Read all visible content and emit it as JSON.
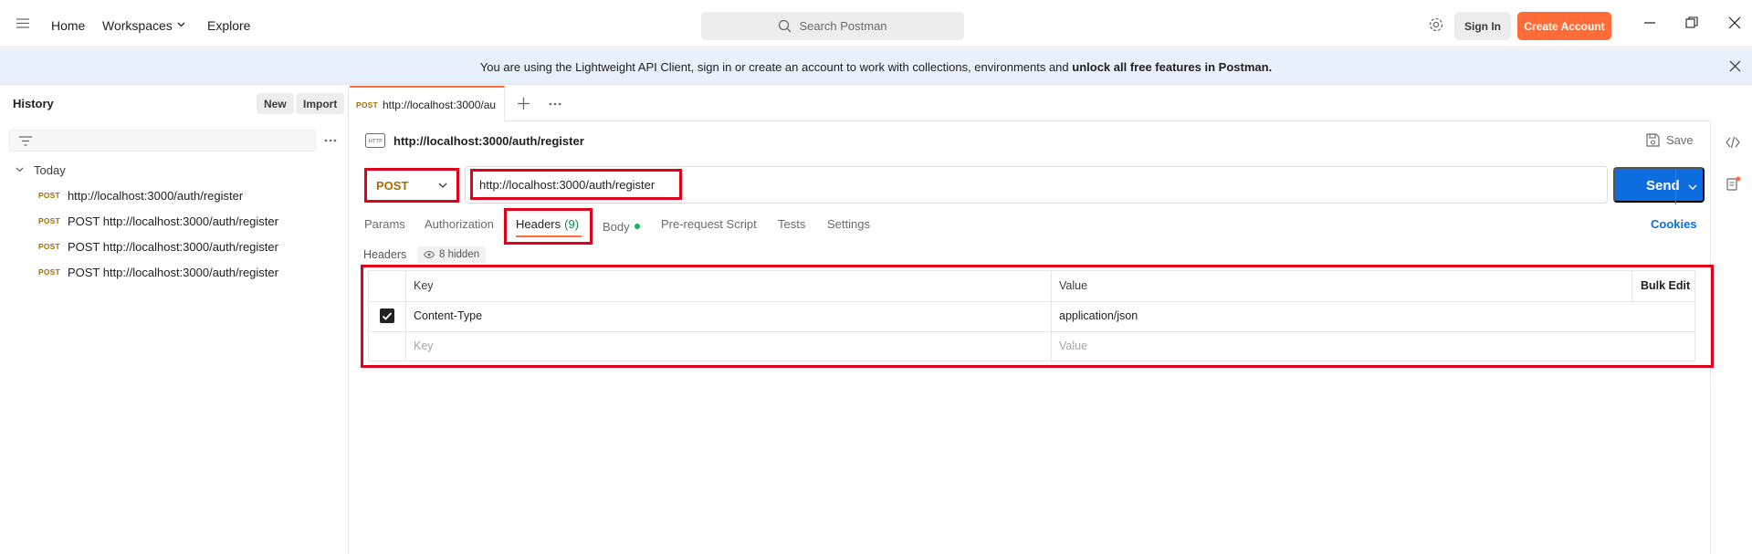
{
  "topbar": {
    "nav": {
      "home": "Home",
      "workspaces": "Workspaces",
      "explore": "Explore"
    },
    "search_placeholder": "Search Postman",
    "sign_in": "Sign In",
    "create_account": "Create Account"
  },
  "banner": {
    "text": "You are using the Lightweight API Client, sign in or create an account to work with collections, environments and ",
    "bold": "unlock all free features in Postman."
  },
  "sidebar": {
    "title": "History",
    "new_label": "New",
    "import_label": "Import",
    "group": "Today",
    "items": [
      {
        "method": "POST",
        "text": "http://localhost:3000/auth/register"
      },
      {
        "method": "POST",
        "text": "POST http://localhost:3000/auth/register"
      },
      {
        "method": "POST",
        "text": "POST http://localhost:3000/auth/register"
      },
      {
        "method": "POST",
        "text": "POST http://localhost:3000/auth/register"
      }
    ]
  },
  "tabs": {
    "active": {
      "method": "POST",
      "title": "http://localhost:3000/au"
    }
  },
  "request": {
    "title": "http://localhost:3000/auth/register",
    "save_label": "Save",
    "method": "POST",
    "url": "http://localhost:3000/auth/register",
    "send_label": "Send",
    "cookies_label": "Cookies",
    "subtabs": {
      "params": "Params",
      "authorization": "Authorization",
      "headers": "Headers",
      "headers_count": "(9)",
      "body": "Body",
      "prerequest": "Pre-request Script",
      "tests": "Tests",
      "settings": "Settings"
    },
    "headers_section_label": "Headers",
    "hidden_label": "8 hidden"
  },
  "headers_table": {
    "col_key": "Key",
    "col_value": "Value",
    "bulk_edit": "Bulk Edit",
    "rows": [
      {
        "checked": true,
        "key": "Content-Type",
        "value": "application/json"
      }
    ],
    "placeholder_key": "Key",
    "placeholder_value": "Value"
  },
  "colors": {
    "accent": "#ff6c37",
    "send": "#0d6cde",
    "post_method": "#a96b00",
    "highlight": "#e0001a"
  }
}
